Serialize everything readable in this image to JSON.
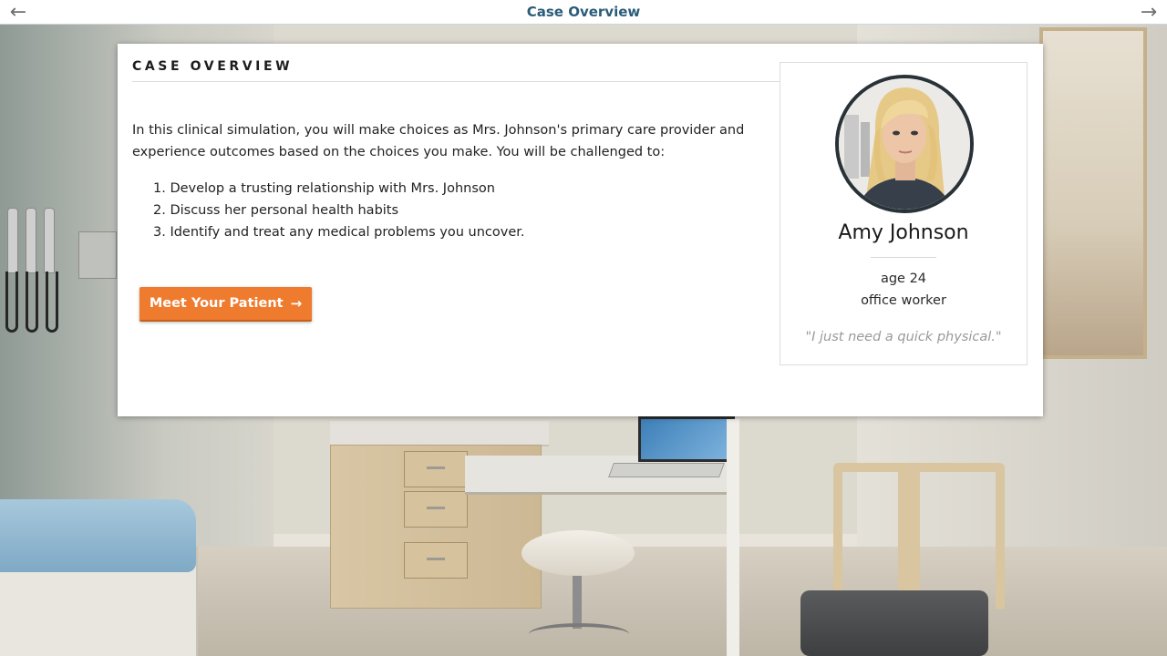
{
  "topbar": {
    "title": "Case Overview",
    "back_icon": "arrow-left-icon",
    "forward_icon": "arrow-right-icon",
    "back_glyph": "←",
    "forward_glyph": "→"
  },
  "overview": {
    "heading": "CASE OVERVIEW",
    "intro": "In this clinical simulation, you will make choices as Mrs. Johnson's primary care provider and experience outcomes based on the choices you make. You will be challenged to:",
    "goals": [
      "1. Develop a trusting relationship with Mrs. Johnson",
      "2. Discuss her personal health habits",
      "3. Identify and treat any medical problems you uncover."
    ],
    "button_label": "Meet Your Patient",
    "button_icon": "arrow-right-icon",
    "button_glyph": "→"
  },
  "patient": {
    "name": "Amy Johnson",
    "age": "age 24",
    "occupation": "office worker",
    "quote": "\"I just need a quick physical.\""
  },
  "colors": {
    "title_blue": "#2a5c79",
    "button_orange": "#ee7b2e",
    "avatar_ring": "#283237"
  }
}
